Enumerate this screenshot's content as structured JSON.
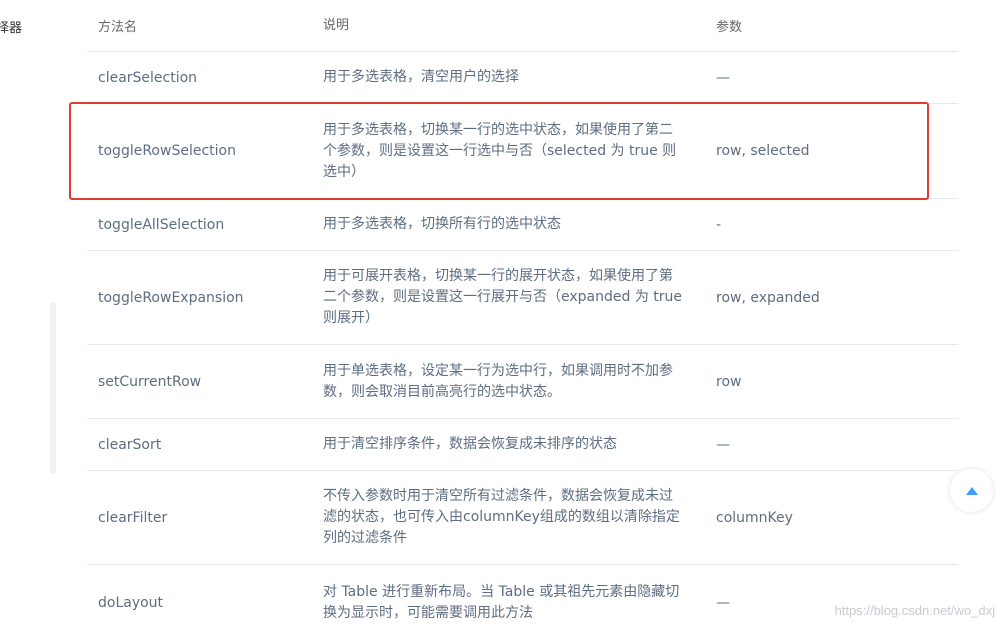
{
  "sidebar": {
    "fragment": "择器"
  },
  "table": {
    "headers": {
      "method": "方法名",
      "desc": "说明",
      "params": "参数"
    },
    "rows": [
      {
        "method": "clearSelection",
        "desc": "用于多选表格，清空用户的选择",
        "params": "—"
      },
      {
        "method": "toggleRowSelection",
        "desc": "用于多选表格，切换某一行的选中状态，如果使用了第二个参数，则是设置这一行选中与否（selected 为 true 则选中）",
        "params": "row, selected"
      },
      {
        "method": "toggleAllSelection",
        "desc": "用于多选表格，切换所有行的选中状态",
        "params": "-"
      },
      {
        "method": "toggleRowExpansion",
        "desc": "用于可展开表格，切换某一行的展开状态，如果使用了第二个参数，则是设置这一行展开与否（expanded 为 true 则展开）",
        "params": "row, expanded"
      },
      {
        "method": "setCurrentRow",
        "desc": "用于单选表格，设定某一行为选中行，如果调用时不加参数，则会取消目前高亮行的选中状态。",
        "params": "row"
      },
      {
        "method": "clearSort",
        "desc": "用于清空排序条件，数据会恢复成未排序的状态",
        "params": "—"
      },
      {
        "method": "clearFilter",
        "desc": "不传入参数时用于清空所有过滤条件，数据会恢复成未过滤的状态，也可传入由columnKey组成的数组以清除指定列的过滤条件",
        "params": "columnKey"
      },
      {
        "method": "doLayout",
        "desc": "对 Table 进行重新布局。当 Table 或其祖先元素由隐藏切换为显示时，可能需要调用此方法",
        "params": "—"
      }
    ]
  },
  "back_to_top": {
    "icon": "caret-up-icon",
    "color": "#409eff"
  },
  "highlight": {
    "color": "#e53935"
  },
  "watermark": "https://blog.csdn.net/wo_dxj"
}
